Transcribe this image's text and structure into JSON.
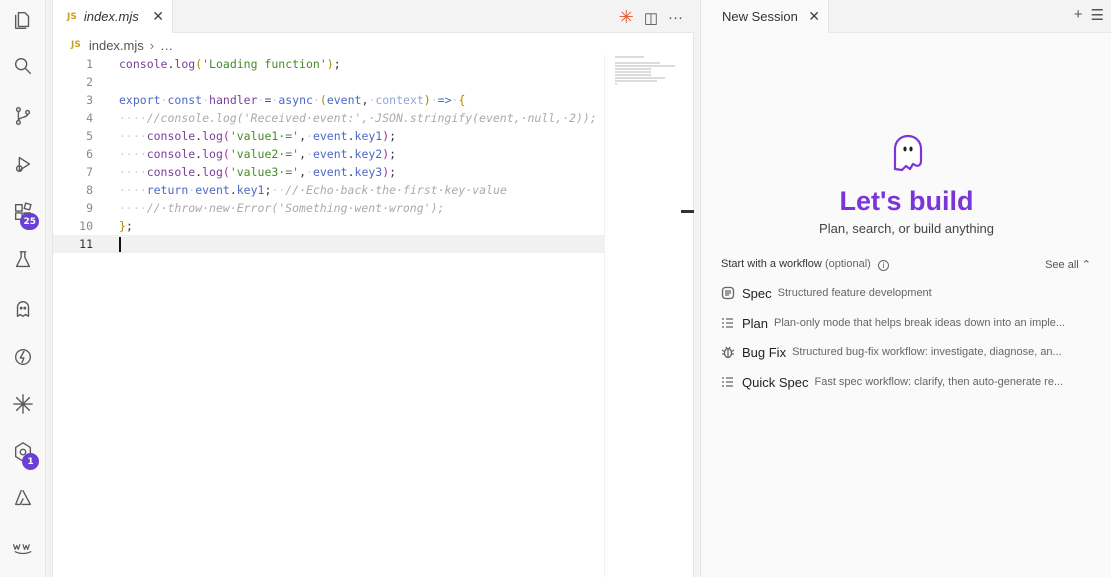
{
  "activity_bar": {
    "items": [
      {
        "icon": "explorer-icon"
      },
      {
        "icon": "search-icon"
      },
      {
        "icon": "source-control-icon"
      },
      {
        "icon": "run-debug-icon"
      },
      {
        "icon": "extensions-icon",
        "badge": "25"
      },
      {
        "icon": "testing-icon"
      },
      {
        "icon": "kiro-ghost-icon"
      },
      {
        "icon": "lightning-icon"
      },
      {
        "icon": "spark-icon"
      },
      {
        "icon": "hexagon-icon",
        "badge": "1"
      },
      {
        "icon": "azure-icon"
      },
      {
        "icon": "aws-icon"
      }
    ]
  },
  "editor": {
    "tab": {
      "lang": "JS",
      "title": "index.mjs"
    },
    "breadcrumb": {
      "lang": "JS",
      "file": "index.mjs",
      "rest": "…"
    },
    "actions": {
      "spark": "✳",
      "split": "◫",
      "more": "···"
    },
    "lines": [
      [
        [
          "tk-fn",
          "console"
        ],
        [
          "tk-pl",
          "."
        ],
        [
          "tk-fn",
          "log"
        ],
        [
          "tk-br1",
          "("
        ],
        [
          "tk-str",
          "'Loading function'"
        ],
        [
          "tk-br1",
          ")"
        ],
        [
          "tk-pl",
          ";"
        ]
      ],
      [],
      [
        [
          "tk-kw",
          "export"
        ],
        [
          "tk-ws",
          "·"
        ],
        [
          "tk-kw",
          "const"
        ],
        [
          "tk-ws",
          "·"
        ],
        [
          "tk-var",
          "handler"
        ],
        [
          "tk-ws",
          "·"
        ],
        [
          "tk-op",
          "="
        ],
        [
          "tk-ws",
          "·"
        ],
        [
          "tk-kw",
          "async"
        ],
        [
          "tk-ws",
          "·"
        ],
        [
          "tk-br1",
          "("
        ],
        [
          "tk-pm",
          "event"
        ],
        [
          "tk-pl",
          ","
        ],
        [
          "tk-ws",
          "·"
        ],
        [
          "tk-pmd",
          "context"
        ],
        [
          "tk-br1",
          ")"
        ],
        [
          "tk-ws",
          "·"
        ],
        [
          "tk-kw",
          "=>"
        ],
        [
          "tk-ws",
          "·"
        ],
        [
          "tk-br1",
          "{"
        ]
      ],
      [
        [
          "tk-ws",
          "····"
        ],
        [
          "tk-cm",
          "//console.log('Received·event:',·JSON.stringify(event,·null,·2));"
        ]
      ],
      [
        [
          "tk-ws",
          "····"
        ],
        [
          "tk-fn",
          "console"
        ],
        [
          "tk-pl",
          "."
        ],
        [
          "tk-fn",
          "log"
        ],
        [
          "tk-br2",
          "("
        ],
        [
          "tk-str",
          "'value1·='"
        ],
        [
          "tk-pl",
          ","
        ],
        [
          "tk-ws",
          "·"
        ],
        [
          "tk-pm",
          "event"
        ],
        [
          "tk-pl",
          "."
        ],
        [
          "tk-pm",
          "key1"
        ],
        [
          "tk-br2",
          ")"
        ],
        [
          "tk-pl",
          ";"
        ]
      ],
      [
        [
          "tk-ws",
          "····"
        ],
        [
          "tk-fn",
          "console"
        ],
        [
          "tk-pl",
          "."
        ],
        [
          "tk-fn",
          "log"
        ],
        [
          "tk-br2",
          "("
        ],
        [
          "tk-str",
          "'value2·='"
        ],
        [
          "tk-pl",
          ","
        ],
        [
          "tk-ws",
          "·"
        ],
        [
          "tk-pm",
          "event"
        ],
        [
          "tk-pl",
          "."
        ],
        [
          "tk-pm",
          "key2"
        ],
        [
          "tk-br2",
          ")"
        ],
        [
          "tk-pl",
          ";"
        ]
      ],
      [
        [
          "tk-ws",
          "····"
        ],
        [
          "tk-fn",
          "console"
        ],
        [
          "tk-pl",
          "."
        ],
        [
          "tk-fn",
          "log"
        ],
        [
          "tk-br2",
          "("
        ],
        [
          "tk-str",
          "'value3·='"
        ],
        [
          "tk-pl",
          ","
        ],
        [
          "tk-ws",
          "·"
        ],
        [
          "tk-pm",
          "event"
        ],
        [
          "tk-pl",
          "."
        ],
        [
          "tk-pm",
          "key3"
        ],
        [
          "tk-br2",
          ")"
        ],
        [
          "tk-pl",
          ";"
        ]
      ],
      [
        [
          "tk-ws",
          "····"
        ],
        [
          "tk-kw",
          "return"
        ],
        [
          "tk-ws",
          "·"
        ],
        [
          "tk-pm",
          "event"
        ],
        [
          "tk-pl",
          "."
        ],
        [
          "tk-pm",
          "key1"
        ],
        [
          "tk-pl",
          ";"
        ],
        [
          "tk-ws",
          "··"
        ],
        [
          "tk-cm",
          "//·Echo·back·the·first·key·value"
        ]
      ],
      [
        [
          "tk-ws",
          "····"
        ],
        [
          "tk-cm",
          "//·throw·new·Error('Something·went·wrong');"
        ]
      ],
      [
        [
          "tk-br1",
          "}"
        ],
        [
          "tk-pl",
          ";"
        ]
      ],
      []
    ],
    "active_line": 11
  },
  "session_panel": {
    "tab_title": "New Session",
    "actions": {
      "add": "+",
      "list": "☰"
    },
    "title": "Let's build",
    "subtitle": "Plan, search, or build anything",
    "workflow_header": {
      "label": "Start with a workflow",
      "optional": "(optional)",
      "info": "i",
      "see_all": "See all ⌃"
    },
    "workflows": [
      {
        "icon": "spec-icon",
        "name": "Spec",
        "desc": "Structured feature development"
      },
      {
        "icon": "plan-icon",
        "name": "Plan",
        "desc": "Plan-only mode that helps break ideas down into an imple..."
      },
      {
        "icon": "bug-icon",
        "name": "Bug Fix",
        "desc": "Structured bug-fix workflow: investigate, diagnose, an..."
      },
      {
        "icon": "quick-spec-icon",
        "name": "Quick Spec",
        "desc": "Fast spec workflow: clarify, then auto-generate re..."
      }
    ]
  }
}
